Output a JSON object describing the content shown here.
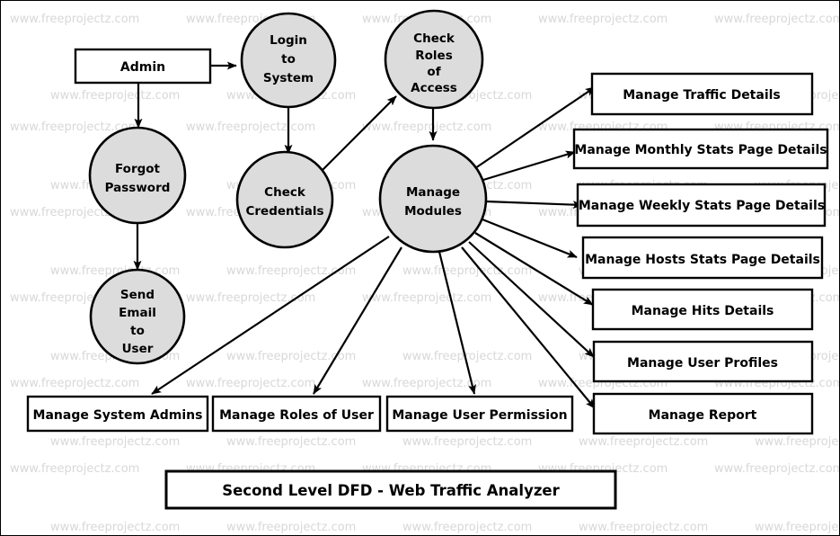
{
  "diagram": {
    "title": "Second Level DFD - Web Traffic Analyzer",
    "watermark_text": "www.freeprojectz.com",
    "colors": {
      "process_fill": "#dcdcdc",
      "box_fill": "#ffffff",
      "stroke": "#000000",
      "watermark": "#d8d8d8",
      "background": "#ffffff"
    },
    "external_entities": [
      {
        "id": "admin",
        "label": "Admin"
      }
    ],
    "processes": [
      {
        "id": "login",
        "label_lines": [
          "Login",
          "to",
          "System"
        ]
      },
      {
        "id": "check_roles",
        "label_lines": [
          "Check",
          "Roles",
          "of",
          "Access"
        ]
      },
      {
        "id": "forgot",
        "label_lines": [
          "Forgot",
          "Password"
        ]
      },
      {
        "id": "check_cred",
        "label_lines": [
          "Check",
          "Credentials"
        ]
      },
      {
        "id": "manage_modules",
        "label_lines": [
          "Manage",
          "Modules"
        ]
      },
      {
        "id": "send_email",
        "label_lines": [
          "Send",
          "Email",
          "to",
          "User"
        ]
      }
    ],
    "data_stores": [
      {
        "id": "traffic",
        "label": "Manage Traffic Details"
      },
      {
        "id": "monthly",
        "label": "Manage Monthly Stats Page Details"
      },
      {
        "id": "weekly",
        "label": "Manage Weekly Stats Page Details"
      },
      {
        "id": "hosts",
        "label": "Manage Hosts Stats Page Details"
      },
      {
        "id": "hits",
        "label": "Manage Hits Details"
      },
      {
        "id": "profiles",
        "label": "Manage User Profiles"
      },
      {
        "id": "report",
        "label": "Manage Report"
      },
      {
        "id": "sysadmins",
        "label": "Manage System Admins"
      },
      {
        "id": "roles",
        "label": "Manage Roles of User"
      },
      {
        "id": "permission",
        "label": "Manage User Permission"
      }
    ],
    "flows": [
      {
        "from": "admin",
        "to": "login"
      },
      {
        "from": "admin",
        "to": "forgot"
      },
      {
        "from": "forgot",
        "to": "send_email"
      },
      {
        "from": "login",
        "to": "check_cred"
      },
      {
        "from": "check_cred",
        "to": "check_roles"
      },
      {
        "from": "check_roles",
        "to": "manage_modules"
      },
      {
        "from": "manage_modules",
        "to": "traffic"
      },
      {
        "from": "manage_modules",
        "to": "monthly"
      },
      {
        "from": "manage_modules",
        "to": "weekly"
      },
      {
        "from": "manage_modules",
        "to": "hosts"
      },
      {
        "from": "manage_modules",
        "to": "hits"
      },
      {
        "from": "manage_modules",
        "to": "profiles"
      },
      {
        "from": "manage_modules",
        "to": "report"
      },
      {
        "from": "manage_modules",
        "to": "sysadmins"
      },
      {
        "from": "manage_modules",
        "to": "roles"
      },
      {
        "from": "manage_modules",
        "to": "permission"
      }
    ]
  }
}
